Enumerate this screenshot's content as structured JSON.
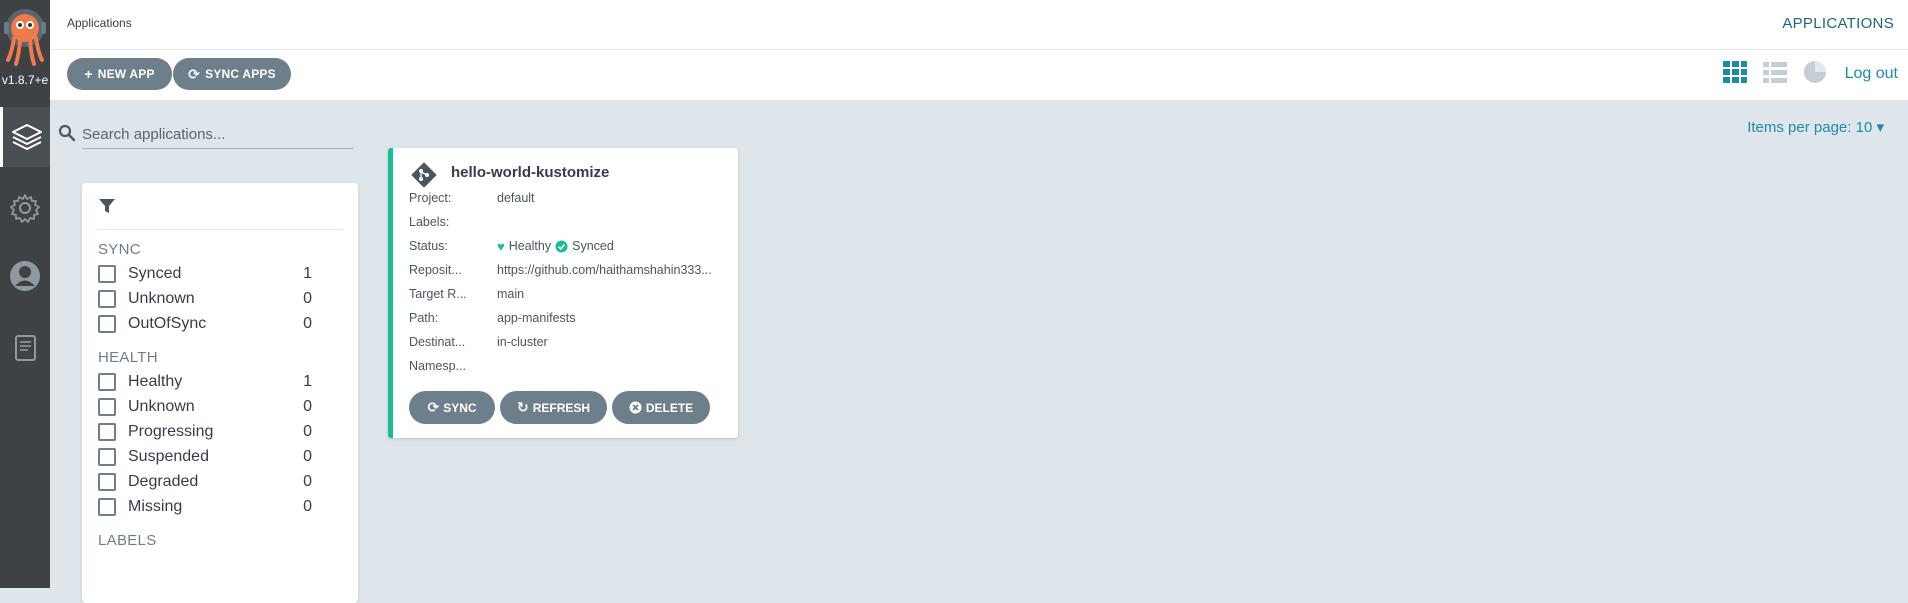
{
  "app": {
    "version": "v1.8.7+e",
    "breadcrumb": "Applications",
    "page_title": "APPLICATIONS",
    "logout_label": "Log out"
  },
  "toolbar": {
    "new_app_label": "NEW APP",
    "sync_apps_label": "SYNC APPS",
    "view_icons": [
      "tiles-view-icon",
      "list-view-icon",
      "summary-pie-icon"
    ],
    "active_view": "tiles"
  },
  "search": {
    "placeholder": "Search applications...",
    "value": ""
  },
  "pagination": {
    "items_per_page_label": "Items per page: 10"
  },
  "filters": {
    "sync": {
      "title": "SYNC",
      "items": [
        {
          "label": "Synced",
          "count": "1"
        },
        {
          "label": "Unknown",
          "count": "0"
        },
        {
          "label": "OutOfSync",
          "count": "0"
        }
      ]
    },
    "health": {
      "title": "HEALTH",
      "items": [
        {
          "label": "Healthy",
          "count": "1"
        },
        {
          "label": "Unknown",
          "count": "0"
        },
        {
          "label": "Progressing",
          "count": "0"
        },
        {
          "label": "Suspended",
          "count": "0"
        },
        {
          "label": "Degraded",
          "count": "0"
        },
        {
          "label": "Missing",
          "count": "0"
        }
      ]
    },
    "labels_title": "LABELS"
  },
  "application": {
    "name": "hello-world-kustomize",
    "fields": [
      {
        "key": "Project:",
        "value": "default"
      },
      {
        "key": "Labels:",
        "value": ""
      },
      {
        "key": "Status:",
        "value": ""
      },
      {
        "key": "Reposit...",
        "value": "https://github.com/haithamshahin333..."
      },
      {
        "key": "Target R...",
        "value": "main"
      },
      {
        "key": "Path:",
        "value": "app-manifests"
      },
      {
        "key": "Destinat...",
        "value": "in-cluster"
      },
      {
        "key": "Namesp...",
        "value": ""
      }
    ],
    "health_status": "Healthy",
    "sync_status": "Synced",
    "actions": {
      "sync": "SYNC",
      "refresh": "REFRESH",
      "delete": "DELETE"
    }
  },
  "colors": {
    "accent": "#1c8ca7",
    "healthy": "#18be94",
    "button": "#6d7f8b",
    "nav": "#3e4245",
    "background": "#dee6eb"
  }
}
